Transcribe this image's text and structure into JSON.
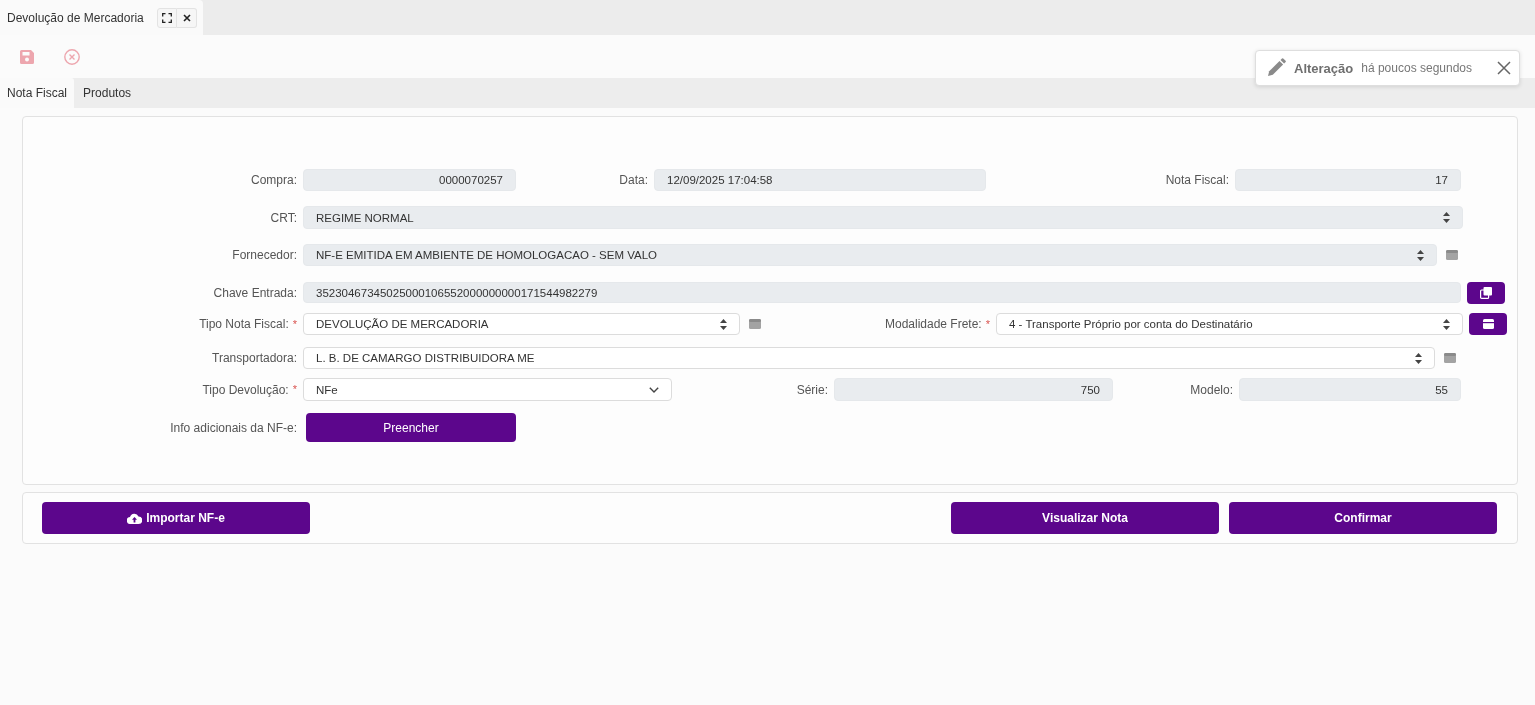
{
  "document_tab": {
    "title": "Devolução de Mercadoria"
  },
  "toolbar": [
    {
      "kind": "save",
      "disabled": true
    },
    {
      "kind": "cancel",
      "disabled": true
    }
  ],
  "notification": {
    "title": "Alteração",
    "text": "há poucos segundos"
  },
  "tabs": [
    {
      "label": "Nota Fiscal",
      "selected": true
    },
    {
      "label": "Produtos",
      "selected": false
    }
  ],
  "form": [
    {
      "fields": [
        {
          "label": "Compra:",
          "kind": "number",
          "value": "0000070257"
        },
        {
          "label": "Data:",
          "kind": "readonly",
          "value": "12/09/2025 17:04:58"
        },
        {
          "label": "Nota Fiscal:",
          "kind": "number",
          "value": "17"
        }
      ]
    },
    {
      "fields": [
        {
          "label": "CRT:",
          "kind": "locked-select",
          "value": "REGIME NORMAL"
        }
      ]
    },
    {
      "fields": [
        {
          "label": "Fornecedor:",
          "kind": "locked-select",
          "value": "NF-E EMITIDA EM AMBIENTE DE HOMOLOGACAO - SEM VALO",
          "addon": {
            "kind": "card"
          }
        }
      ]
    },
    {
      "fields": [
        {
          "label": "Chave Entrada:",
          "kind": "readonly",
          "value": "35230467345025000106552000000000171544982279",
          "addon": {
            "kind": "copy"
          }
        }
      ]
    },
    {
      "fields": [
        {
          "label": "Tipo Nota Fiscal:",
          "marker": "*",
          "kind": "select",
          "value": "DEVOLUÇÃO DE MERCADORIA",
          "addon": {
            "kind": "card"
          }
        },
        {
          "label": "Modalidade Frete:",
          "marker": "*",
          "kind": "select",
          "value": "4 - Transporte Próprio por conta do Destinatário",
          "addon": {
            "kind": "box"
          }
        }
      ]
    },
    {
      "fields": [
        {
          "label": "Transportadora:",
          "kind": "select",
          "value": "L. B. DE CAMARGO DISTRIBUIDORA ME",
          "addon": {
            "kind": "card"
          }
        }
      ]
    },
    {
      "fields": [
        {
          "label": "Tipo Devolução:",
          "marker": "*",
          "kind": "dropdown",
          "value": "NFe"
        },
        {
          "label": "Série:",
          "kind": "number",
          "value": "750"
        },
        {
          "label": "Modelo:",
          "kind": "number",
          "value": "55"
        }
      ]
    },
    {
      "fields": [
        {
          "label": "Info adicionais da NF-e:",
          "kind": "button",
          "value": "Preencher"
        }
      ]
    }
  ],
  "actions": [
    {
      "label": "Importar NF-e",
      "kind": "upload"
    },
    {
      "label": "Visualizar Nota",
      "kind": "plain"
    },
    {
      "label": "Confirmar",
      "kind": "plain"
    }
  ]
}
